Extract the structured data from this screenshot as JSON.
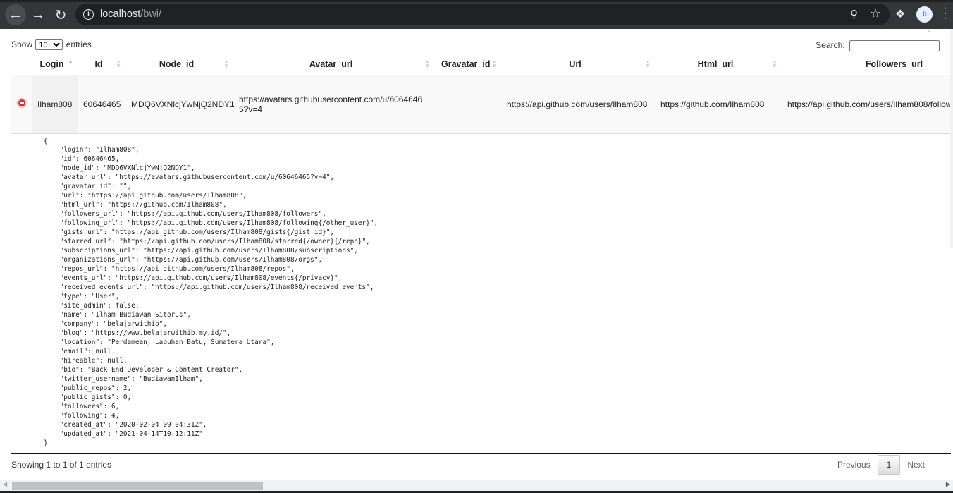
{
  "browser": {
    "url_host": "localhost",
    "url_path": "/bwi/",
    "profile_initials": "b"
  },
  "datatable": {
    "length_label_before": "Show",
    "length_value": "10",
    "length_label_after": "entries",
    "search_label": "Search:",
    "search_value": "",
    "columns": [
      {
        "label": "Login",
        "sort": "asc"
      },
      {
        "label": "Id",
        "sort": "both"
      },
      {
        "label": "Node_id",
        "sort": "both"
      },
      {
        "label": "Avatar_url",
        "sort": "both"
      },
      {
        "label": "Gravatar_id",
        "sort": "both"
      },
      {
        "label": "Url",
        "sort": "both"
      },
      {
        "label": "Html_url",
        "sort": "both"
      },
      {
        "label": "Followers_url",
        "sort": "both"
      }
    ],
    "rows": [
      {
        "login": "Ilham808",
        "id": "60646465",
        "node_id": "MDQ6VXNlcjYwNjQ2NDY1",
        "avatar_url": "https://avatars.githubusercontent.com/u/60646465?v=4",
        "gravatar_id": "",
        "url": "https://api.github.com/users/Ilham808",
        "html_url": "https://github.com/Ilham808",
        "followers_url": "https://api.github.com/users/Ilham808/followers"
      }
    ],
    "child_json": "{\n    \"login\": \"Ilham808\",\n    \"id\": 60646465,\n    \"node_id\": \"MDQ6VXNlcjYwNjQ2NDY1\",\n    \"avatar_url\": \"https://avatars.githubusercontent.com/u/60646465?v=4\",\n    \"gravatar_id\": \"\",\n    \"url\": \"https://api.github.com/users/Ilham808\",\n    \"html_url\": \"https://github.com/Ilham808\",\n    \"followers_url\": \"https://api.github.com/users/Ilham808/followers\",\n    \"following_url\": \"https://api.github.com/users/Ilham808/following{/other_user}\",\n    \"gists_url\": \"https://api.github.com/users/Ilham808/gists{/gist_id}\",\n    \"starred_url\": \"https://api.github.com/users/Ilham808/starred{/owner}{/repo}\",\n    \"subscriptions_url\": \"https://api.github.com/users/Ilham808/subscriptions\",\n    \"organizations_url\": \"https://api.github.com/users/Ilham808/orgs\",\n    \"repos_url\": \"https://api.github.com/users/Ilham808/repos\",\n    \"events_url\": \"https://api.github.com/users/Ilham808/events{/privacy}\",\n    \"received_events_url\": \"https://api.github.com/users/Ilham808/received_events\",\n    \"type\": \"User\",\n    \"site_admin\": false,\n    \"name\": \"Ilham Budiawan Sitorus\",\n    \"company\": \"belajarwithib\",\n    \"blog\": \"https://www.belajarwithib.my.id/\",\n    \"location\": \"Perdamean, Labuhan Batu, Sumatera Utara\",\n    \"email\": null,\n    \"hireable\": null,\n    \"bio\": \"Back End Developer & Content Creator\",\n    \"twitter_username\": \"BudiawanIlham\",\n    \"public_repos\": 2,\n    \"public_gists\": 0,\n    \"followers\": 6,\n    \"following\": 4,\n    \"created_at\": \"2020-02-04T09:04:31Z\",\n    \"updated_at\": \"2021-04-14T10:12:11Z\"\n}",
    "info": "Showing 1 to 1 of 1 entries",
    "pagination": {
      "previous": "Previous",
      "current": "1",
      "next": "Next"
    }
  },
  "colors": {
    "toolbar": "#35363a",
    "sort_active": "#a6a3d9",
    "row_control": "#d33333"
  }
}
